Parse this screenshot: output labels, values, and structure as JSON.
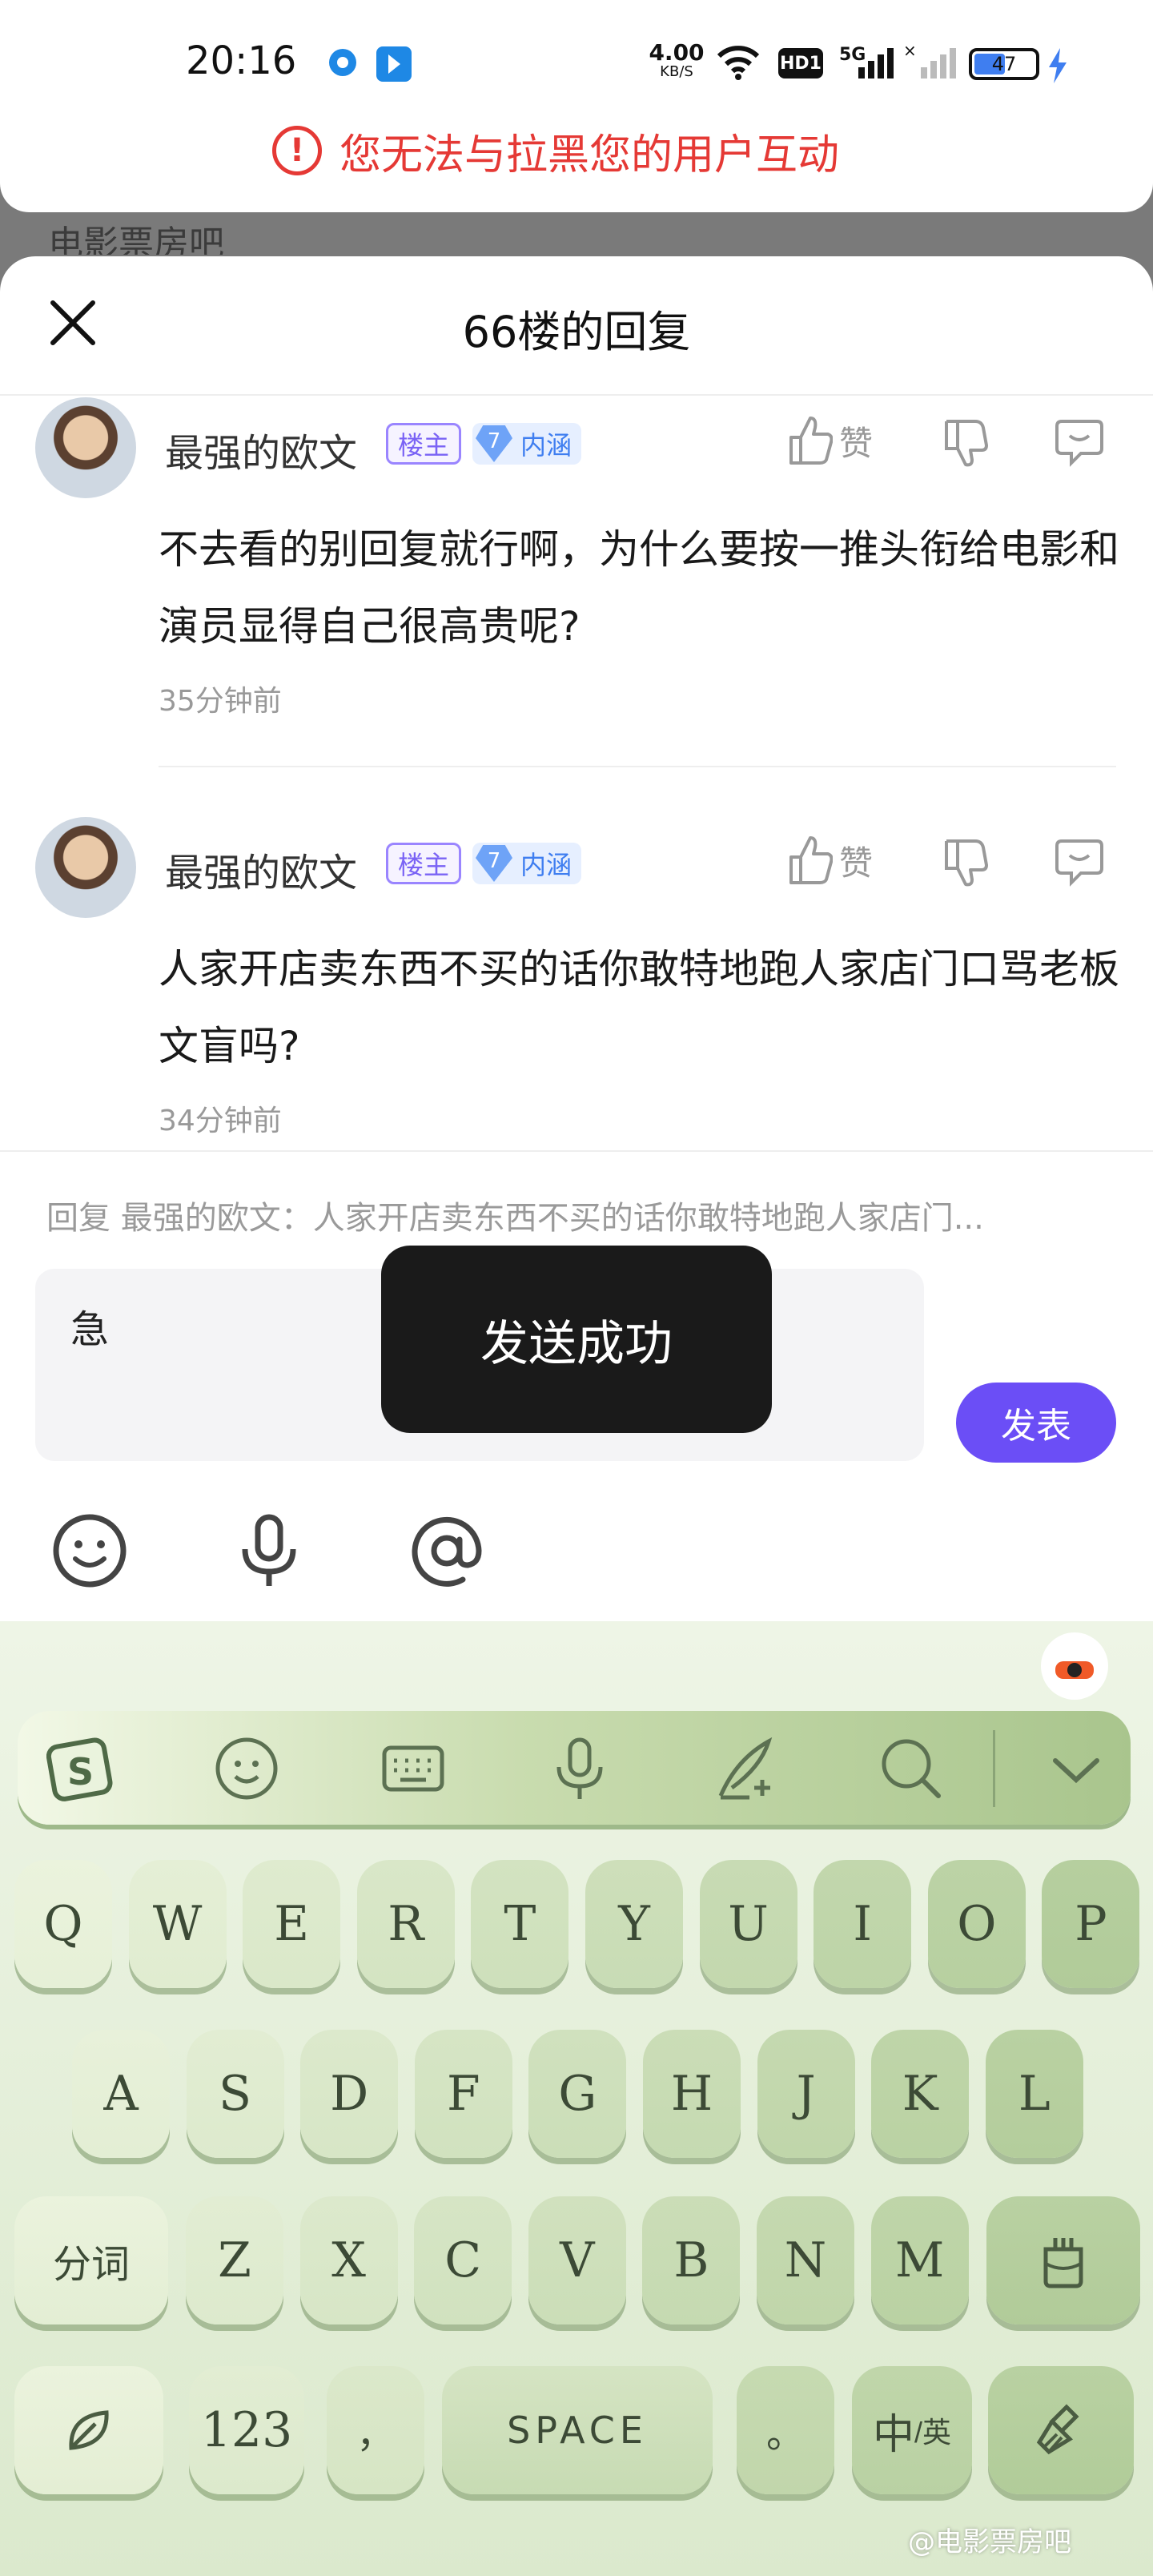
{
  "status_bar": {
    "time": "20:16",
    "net_speed_value": "4.00",
    "net_speed_unit": "KB/S",
    "hd_label": "HD1",
    "signal_label": "5G",
    "battery": "47"
  },
  "banner": {
    "warning": "您无法与拉黑您的用户互动"
  },
  "background_peek": "电影票房吧",
  "sheet": {
    "title": "66楼的回复"
  },
  "comments": [
    {
      "user": "最强的欧文",
      "badge_owner": "楼主",
      "level": "7",
      "badge_level_label": "内涵",
      "like_label": "赞",
      "text": "不去看的别回复就行啊，为什么要按一推头衔给电影和演员显得自己很高贵呢?",
      "time": "35分钟前"
    },
    {
      "user": "最强的欧文",
      "badge_owner": "楼主",
      "level": "7",
      "badge_level_label": "内涵",
      "like_label": "赞",
      "text": "人家开店卖东西不买的话你敢特地跑人家店门口骂老板文盲吗?",
      "time": "34分钟前"
    }
  ],
  "reply": {
    "hint": "回复 最强的欧文：人家开店卖东西不买的话你敢特地跑人家店门...",
    "input_value": "急",
    "publish_label": "发表",
    "toast": "发送成功"
  },
  "keyboard": {
    "row1": [
      "Q",
      "W",
      "E",
      "R",
      "T",
      "Y",
      "U",
      "I",
      "O",
      "P"
    ],
    "row2": [
      "A",
      "S",
      "D",
      "F",
      "G",
      "H",
      "J",
      "K",
      "L"
    ],
    "row3_left": "分词",
    "row3": [
      "Z",
      "X",
      "C",
      "V",
      "B",
      "N",
      "M"
    ],
    "num_label": "123",
    "comma_label": "，",
    "space_label": "SPACE",
    "period_label": "。",
    "lang_main": "中",
    "lang_sub": "/英"
  },
  "watermark": "@电影票房吧",
  "colors": {
    "accent": "#6b4ef6",
    "warning": "#e53935",
    "keyboard_bg": "#dbe9cd"
  }
}
